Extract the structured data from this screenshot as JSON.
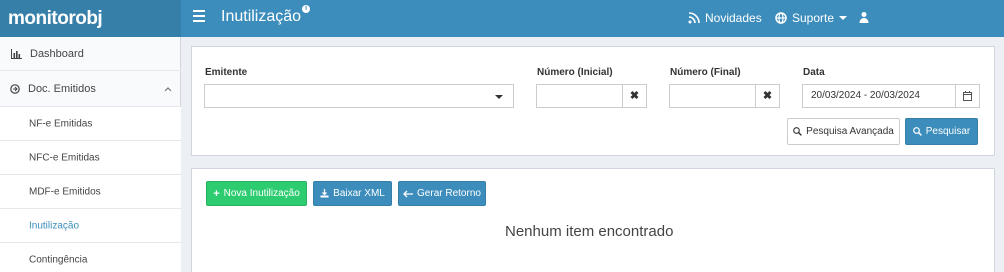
{
  "brand": {
    "logo": "monitorobj"
  },
  "header": {
    "title": "Inutilização",
    "title_badge": "i",
    "nav": {
      "novidades": "Novidades",
      "suporte": "Suporte"
    }
  },
  "sidebar": {
    "dashboard": "Dashboard",
    "doc_emitidos": "Doc. Emitidos",
    "sub_items": [
      "NF-e Emitidas",
      "NFC-e Emitidas",
      "MDF-e Emitidos",
      "Inutilização",
      "Contingência"
    ]
  },
  "filters": {
    "emitente_label": "Emitente",
    "numero_inicial_label": "Número (Inicial)",
    "numero_final_label": "Número (Final)",
    "data_label": "Data",
    "date_range": "20/03/2024 - 20/03/2024",
    "clear_glyph": "✖",
    "advanced_search": "Pesquisa Avançada",
    "search": "Pesquisar"
  },
  "actions": {
    "new_inutilizacao": "Nova Inutilização",
    "download_xml": "Baixar XML",
    "gerar_retorno": "Gerar Retorno"
  },
  "empty_message": "Nenhum item encontrado",
  "colors": {
    "primary": "#3c8dbc",
    "success": "#2ecc71"
  }
}
